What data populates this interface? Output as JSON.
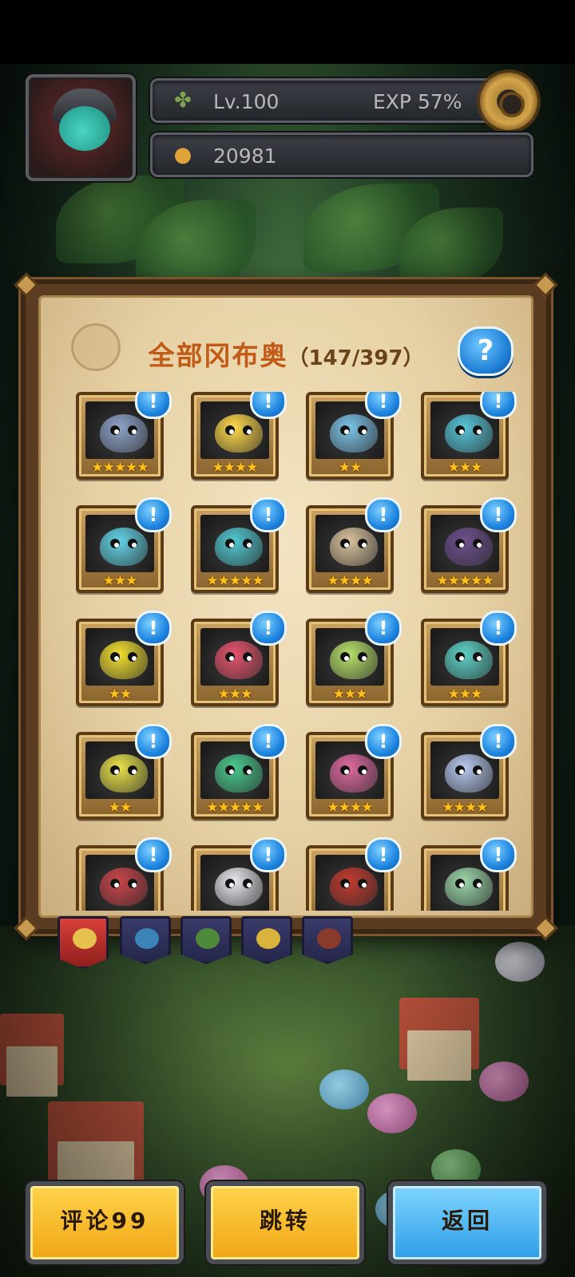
{
  "hud": {
    "level": "Lv.100",
    "exp": "EXP 57%",
    "coins": "20981",
    "level_icon": "clover-icon",
    "coins_icon": "fruit-coin-icon"
  },
  "panel": {
    "title": "全部冈布奥",
    "count": "（147/397）",
    "help_label": "?"
  },
  "collection": {
    "badge_label": "!",
    "cards": [
      {
        "stars": 5,
        "color": "#8ea3c8"
      },
      {
        "stars": 4,
        "color": "#ffd94a"
      },
      {
        "stars": 2,
        "color": "#7cc3e8"
      },
      {
        "stars": 3,
        "color": "#56c6d9"
      },
      {
        "stars": 3,
        "color": "#62d3e6"
      },
      {
        "stars": 5,
        "color": "#4fc7cf"
      },
      {
        "stars": 4,
        "color": "#d9c29c"
      },
      {
        "stars": 5,
        "color": "#6d4f8e"
      },
      {
        "stars": 2,
        "color": "#f2df2f"
      },
      {
        "stars": 3,
        "color": "#e6536c"
      },
      {
        "stars": 3,
        "color": "#b6e06a"
      },
      {
        "stars": 3,
        "color": "#5dd2c8"
      },
      {
        "stars": 2,
        "color": "#e9e34a"
      },
      {
        "stars": 5,
        "color": "#49c98e"
      },
      {
        "stars": 4,
        "color": "#e06aa0"
      },
      {
        "stars": 4,
        "color": "#b6c9f0"
      },
      {
        "stars": 0,
        "color": "#c9444a"
      },
      {
        "stars": 0,
        "color": "#e7e7ee"
      },
      {
        "stars": 0,
        "color": "#c23a2e"
      },
      {
        "stars": 0,
        "color": "#9ad6a8"
      }
    ]
  },
  "buttons": {
    "comment": "评论99",
    "jump": "跳转",
    "back": "返回"
  },
  "tabs": [
    {
      "active": true,
      "color": "#e6c14d"
    },
    {
      "active": false,
      "color": "#3a84b8"
    },
    {
      "active": false,
      "color": "#4f8a3a"
    },
    {
      "active": false,
      "color": "#d8b43a"
    },
    {
      "active": false,
      "color": "#8a3a2a"
    }
  ]
}
